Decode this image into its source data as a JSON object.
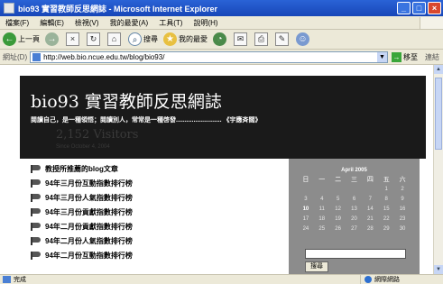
{
  "window": {
    "title": "bio93 實習教師反思網誌 - Microsoft Internet Explorer"
  },
  "menu": {
    "items": [
      "檔案(F)",
      "編輯(E)",
      "檢視(V)",
      "我的最愛(A)",
      "工具(T)",
      "說明(H)"
    ]
  },
  "toolbar": {
    "back_label": "上一頁",
    "search_label": "搜尋",
    "favorites_label": "我的最愛"
  },
  "address": {
    "label": "網址(D)",
    "url": "http://web.bio.ncue.edu.tw/blog/bio93/",
    "go_label": "移至",
    "links_label": "連結"
  },
  "page": {
    "blog_title": "bio93 實習教師反思網誌",
    "tagline": "閱讀自己，是一種領悟；閱讀別人，常常是一種啓發.......................... 《宇應斉闊》",
    "visitors": "2,152 Visitors",
    "since": "Since October 4, 2004",
    "list_heading": "教授所推薦的blog文章",
    "list_items": [
      "94年三月份互動指數排行榜",
      "94年三月份人氣指數排行榜",
      "94年三月份貢獻指數排行榜",
      "94年二月份貢獻指數排行榜",
      "94年二月份人氣指數排行榜",
      "94年二月份互動指數排行榜"
    ],
    "calendar": {
      "month": "April 2005",
      "weekdays": [
        "日",
        "一",
        "二",
        "三",
        "四",
        "五",
        "六"
      ],
      "days": [
        "",
        "",
        "",
        "",
        "",
        "1",
        "2",
        "3",
        "4",
        "5",
        "6",
        "7",
        "8",
        "9",
        "10",
        "11",
        "12",
        "13",
        "14",
        "15",
        "16",
        "17",
        "18",
        "19",
        "20",
        "21",
        "22",
        "23",
        "24",
        "25",
        "26",
        "27",
        "28",
        "29",
        "30"
      ]
    },
    "search_button": "搜尋"
  },
  "status": {
    "text": "完成",
    "zone": "網際網路"
  }
}
